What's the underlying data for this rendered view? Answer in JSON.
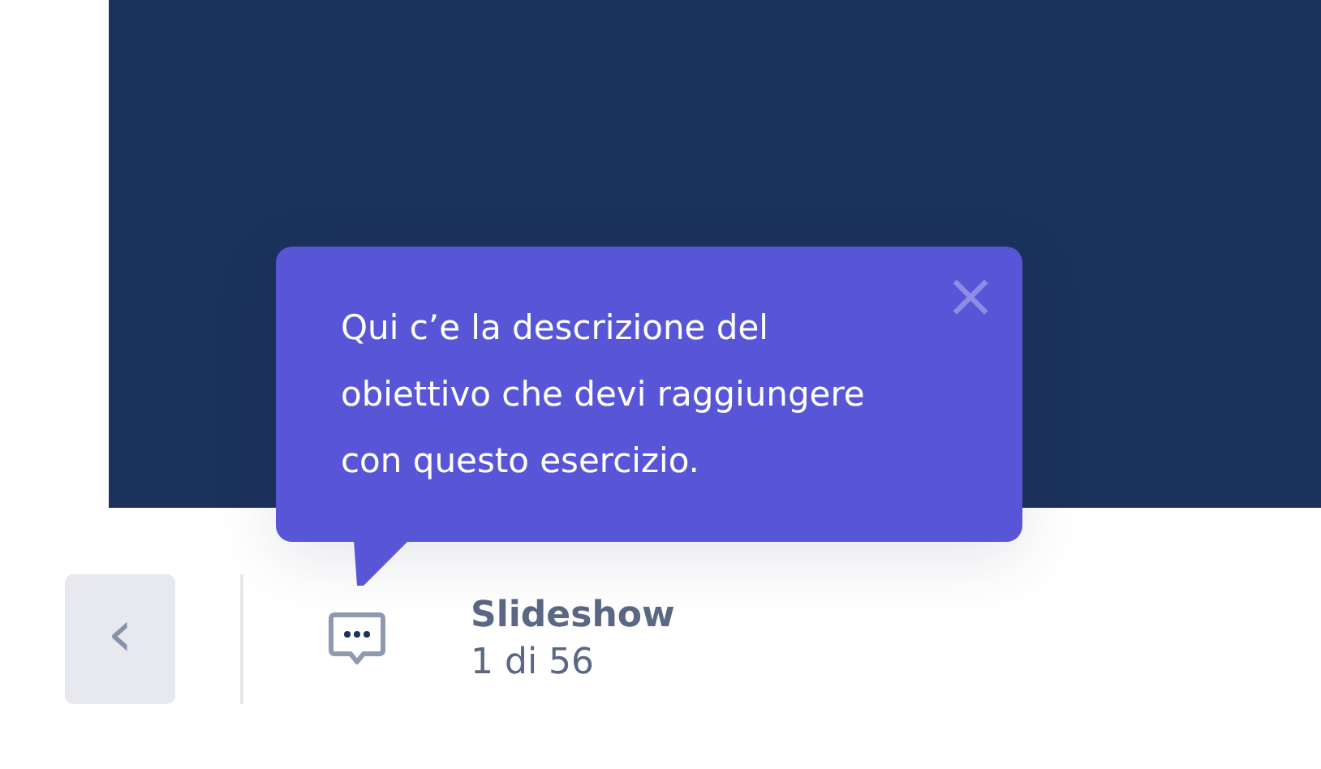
{
  "tooltip": {
    "text": "Qui c’e la descrizione del obiettivo che devi raggiungere con questo esercizio.",
    "close": "×"
  },
  "footer": {
    "back_label": "‹",
    "title": "Slideshow",
    "counter": "1 di 56"
  }
}
